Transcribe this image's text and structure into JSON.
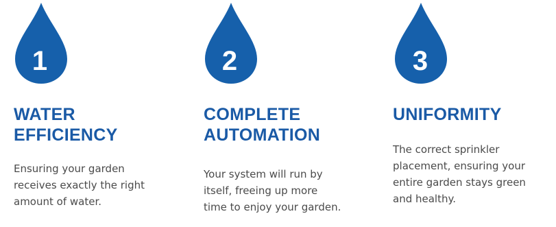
{
  "colors": {
    "accent": "#1a5aa6",
    "drop_fill": "#1660ab",
    "text": "#4a4a4a",
    "background": "#ffffff"
  },
  "features": [
    {
      "icon": "water-drop-icon",
      "number": "1",
      "title_lines": [
        "WATER",
        "EFFICIENCY"
      ],
      "description_lines": [
        "Ensuring your garden",
        "receives exactly the right",
        "amount of water."
      ]
    },
    {
      "icon": "water-drop-icon",
      "number": "2",
      "title_lines": [
        "COMPLETE",
        "AUTOMATION"
      ],
      "description_lines": [
        "Your system will run by",
        "itself, freeing up more",
        "time to enjoy your garden."
      ]
    },
    {
      "icon": "water-drop-icon",
      "number": "3",
      "title_lines": [
        "UNIFORMITY"
      ],
      "description_lines": [
        "The correct sprinkler",
        "placement, ensuring your",
        "entire garden stays green",
        "and healthy."
      ]
    }
  ]
}
